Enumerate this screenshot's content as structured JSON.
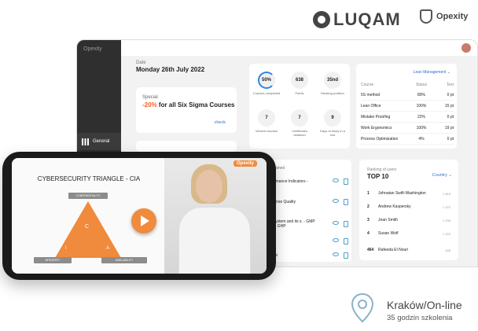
{
  "brands": {
    "luqam": "LUQAM",
    "opexity": "Opexity"
  },
  "sidebar": {
    "logo": "Opexity",
    "menu_item": "General"
  },
  "dashboard": {
    "date_label": "Date",
    "date_value": "Monday 26th July 2022",
    "special": {
      "label": "Special",
      "offer_highlight": "-20%",
      "offer_rest": " for all Six Sigma Courses",
      "check": "check"
    },
    "stats": [
      {
        "value": "50%",
        "label": "Courses completed"
      },
      {
        "value": "638",
        "label": "Points"
      },
      {
        "value": "35nd",
        "label": "Ranking position"
      },
      {
        "value": "7",
        "label": "Viewed courses"
      },
      {
        "value": "7",
        "label": "Certificates obtained"
      },
      {
        "value": "9",
        "label": "Days of study in a row"
      }
    ],
    "courses": {
      "selector": "Lean Management",
      "headers": [
        "Course",
        "Status",
        "Test"
      ],
      "rows": [
        [
          "5S method",
          "80%",
          "0 pt"
        ],
        [
          "Lean Office",
          "100%",
          "15 pt"
        ],
        [
          "Mistake Proofing",
          "22%",
          "0 pt"
        ],
        [
          "Work Ergonomics",
          "100%",
          "19 pt"
        ],
        [
          "Process Optimization",
          "4%",
          "0 pt"
        ]
      ]
    },
    "tasks": {
      "header": "obtained",
      "items": [
        "rformance Indicators -",
        "sponse Quality",
        "P system and its s. - GMP and GHP",
        "",
        "rtobi"
      ]
    },
    "ranking": {
      "label": "Ranking of users",
      "title": "TOP 10",
      "selector": "Country",
      "rows": [
        {
          "rank": "1",
          "name": "Johnatan Swift-Washington",
          "score": "1 815"
        },
        {
          "rank": "2",
          "name": "Andrew Kaspersky",
          "score": "1 470"
        },
        {
          "rank": "3",
          "name": "Joan Smith",
          "score": "1 235"
        },
        {
          "rank": "4",
          "name": "Susan Wolf",
          "score": "1 222"
        },
        {
          "rank": "464",
          "name": "Rafeeda El Nouri",
          "score": "428"
        }
      ]
    }
  },
  "phone": {
    "slide_title": "CYBERSECURITY TRIANGLE - CIA",
    "boxes": {
      "top": "CONFIDENTIALITY",
      "left": "INTEGRITY",
      "right": "AVAILABILITY"
    },
    "letters": {
      "c": "C",
      "i": "I",
      "a": "A"
    },
    "badge": "Opexity"
  },
  "location": {
    "city": "Kraków/On-line",
    "hours": "35 godzin szkolenia"
  },
  "colors": {
    "accent": "#f08a3c",
    "link": "#2a6fd6",
    "sidebar": "#2f2f2f",
    "offer": "#ff5a1f"
  }
}
